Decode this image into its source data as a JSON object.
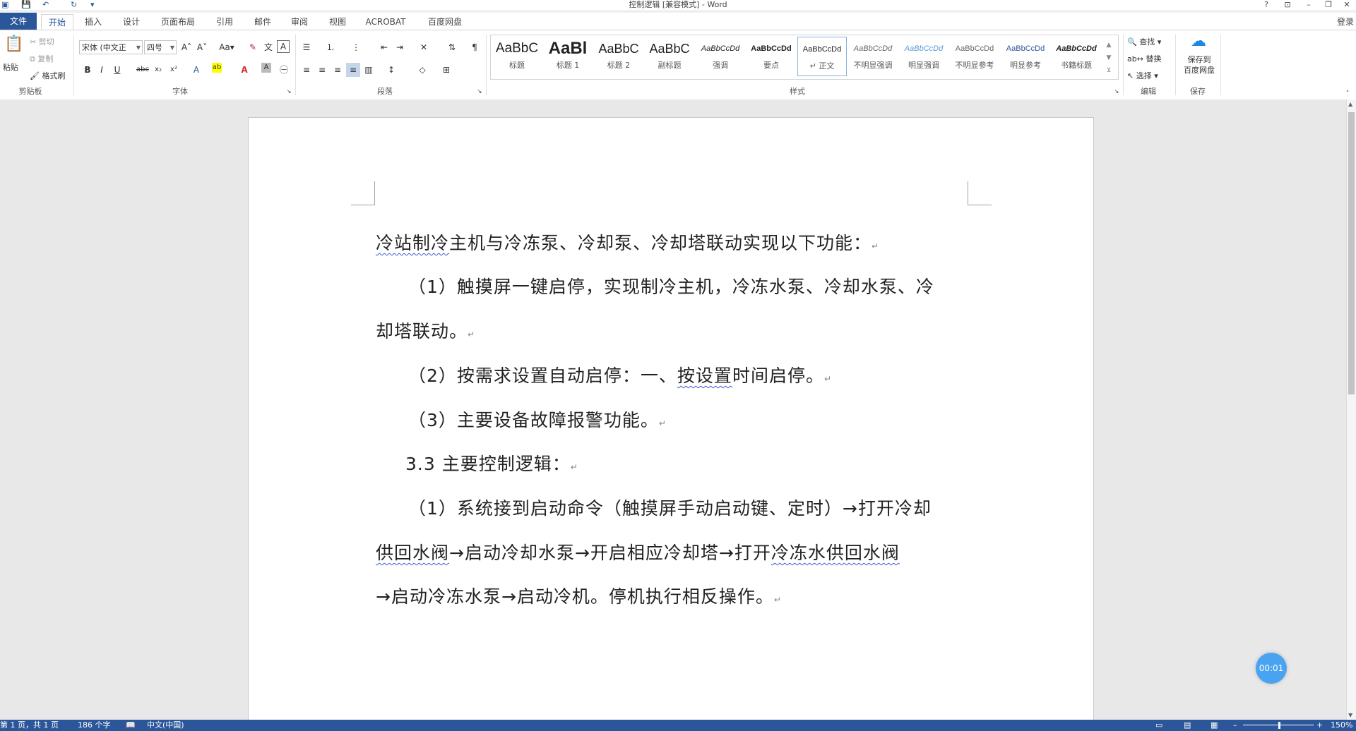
{
  "window": {
    "title": "控制逻辑 [兼容模式] - Word",
    "help": "?",
    "ribbon_opt": "⊡",
    "min": "–",
    "max": "❐",
    "close": "✕",
    "login": "登录"
  },
  "tabs": [
    {
      "label": "文件"
    },
    {
      "label": "开始"
    },
    {
      "label": "插入"
    },
    {
      "label": "设计"
    },
    {
      "label": "页面布局"
    },
    {
      "label": "引用"
    },
    {
      "label": "邮件"
    },
    {
      "label": "审阅"
    },
    {
      "label": "视图"
    },
    {
      "label": "ACROBAT"
    },
    {
      "label": "百度网盘"
    }
  ],
  "clipboard": {
    "paste": "粘贴",
    "cut": "剪切",
    "copy": "复制",
    "format_painter": "格式刷",
    "label": "剪贴板"
  },
  "font": {
    "name": "宋体 (中文正",
    "size": "四号",
    "label": "字体"
  },
  "paragraph": {
    "label": "段落"
  },
  "styles": {
    "label": "样式",
    "items": [
      {
        "sample": "AaBbC",
        "name": "标题"
      },
      {
        "sample": "AaBl",
        "name": "标题 1"
      },
      {
        "sample": "AaBbC",
        "name": "标题 2"
      },
      {
        "sample": "AaBbC",
        "name": "副标题"
      },
      {
        "sample": "AaBbCcDd",
        "name": "强调"
      },
      {
        "sample": "AaBbCcDd",
        "name": "要点"
      },
      {
        "sample": "AaBbCcDd",
        "name": "↵ 正文"
      },
      {
        "sample": "AaBbCcDd",
        "name": "不明显强调"
      },
      {
        "sample": "AaBbCcDd",
        "name": "明显强调"
      },
      {
        "sample": "AaBbCcDd",
        "name": "不明显参考"
      },
      {
        "sample": "AaBbCcDd",
        "name": "明显参考"
      },
      {
        "sample": "AaBbCcDd",
        "name": "书籍标题"
      }
    ]
  },
  "editing": {
    "find": "查找",
    "replace": "替换",
    "select": "选择",
    "label": "编辑"
  },
  "save": {
    "button": "保存到\n百度网盘",
    "label": "保存"
  },
  "document": {
    "p1_a": "冷站制冷",
    "p1_b": "主机与冷冻泵、冷却泵、冷却塔联动实现以下功能：",
    "p2": "（1）触摸屏一键启停，实现制冷主机，冷冻水泵、冷却水泵、冷",
    "p3": "却塔联动。",
    "p4_a": "（2）按需求设置自动启停：一、",
    "p4_b": "按设置",
    "p4_c": "时间启停。",
    "p5": "（3）主要设备故障报警功能。",
    "p6": "3.3 主要控制逻辑：",
    "p7": "（1）系统接到启动命令（触摸屏手动启动键、定时）→打开冷却",
    "p8_a": "供回水阀",
    "p8_b": "→启动冷却水泵→开启相应冷却塔→打开",
    "p8_c": "冷冻水供回水阀",
    "p9": "→启动冷冻水泵→启动冷机。停机执行相反操作。",
    "para_mark": "↵"
  },
  "timer": "00:01",
  "status": {
    "page": "第 1 页，共 1 页",
    "words": "186 个字",
    "lang": "中文(中国)",
    "zoom": "150%"
  }
}
